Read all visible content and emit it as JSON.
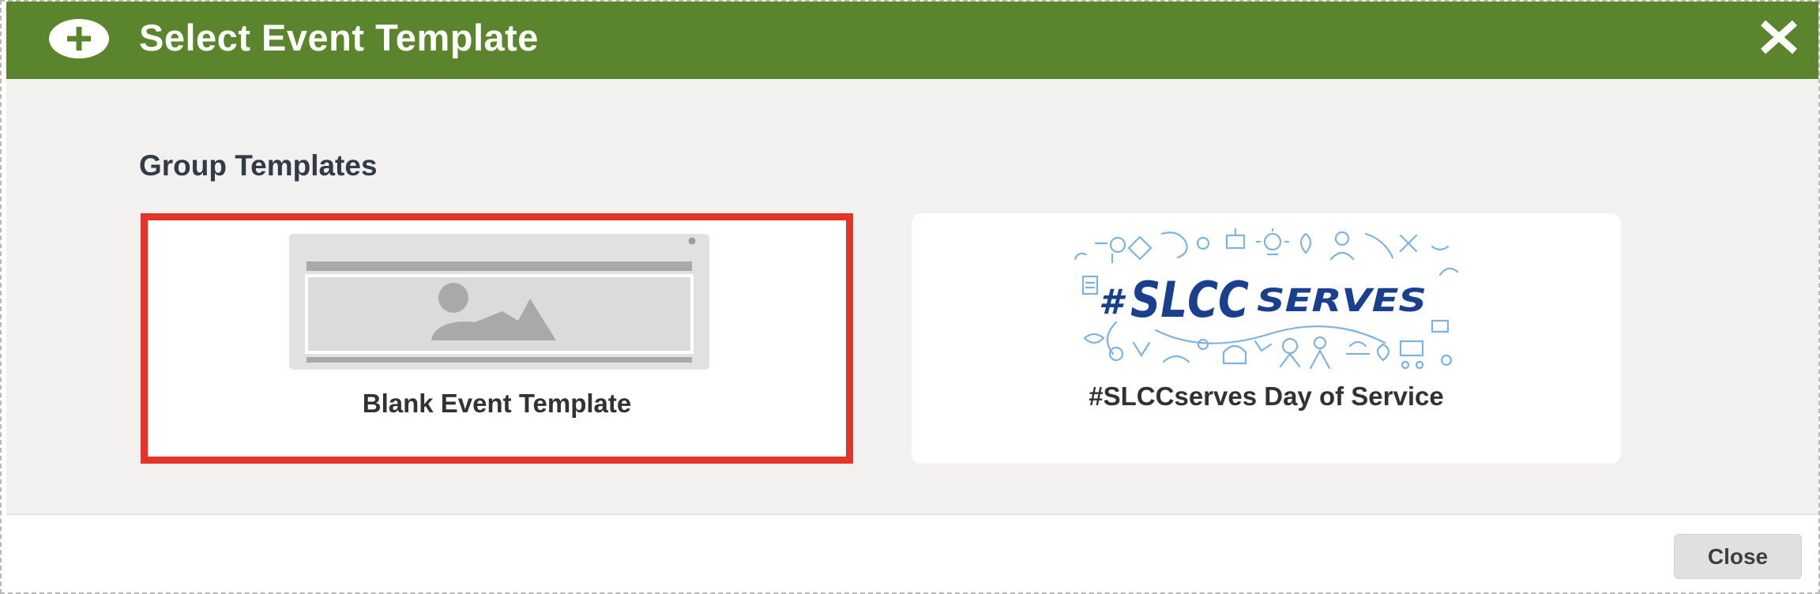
{
  "dialog": {
    "title": "Select Event Template",
    "header_color": "#5b852c",
    "header_icon": "plus-circle-icon",
    "close_icon": "close-x-icon"
  },
  "section": {
    "title": "Group Templates"
  },
  "templates": [
    {
      "label": "Blank Event Template",
      "thumbnail_icon": "image-placeholder-icon",
      "selected": true,
      "highlight_color": "#e33427"
    },
    {
      "label": "#SLCCserves Day of Service",
      "thumbnail_icon": "slccserves-logo",
      "logo_text": {
        "hash": "#",
        "slcc": "SLCC",
        "serves": "SERVES"
      },
      "selected": false
    }
  ],
  "footer": {
    "close_label": "Close"
  }
}
